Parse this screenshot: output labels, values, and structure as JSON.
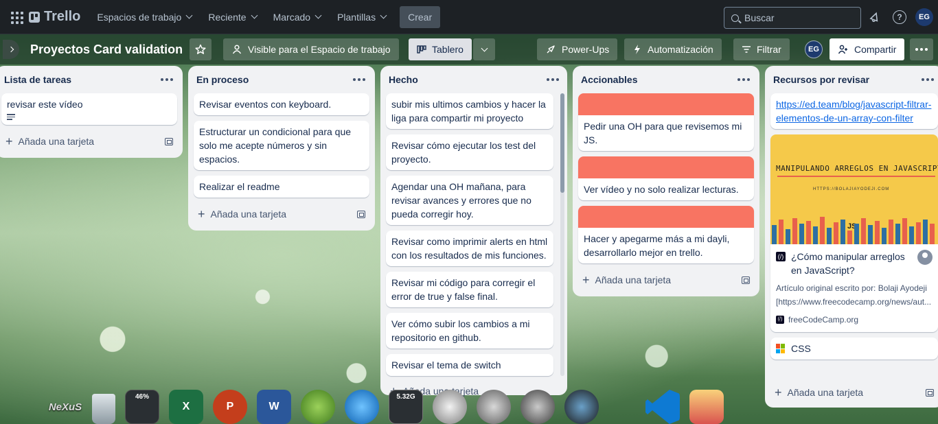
{
  "topbar": {
    "app_name": "Trello",
    "nav": [
      "Espacios de trabajo",
      "Reciente",
      "Marcado",
      "Plantillas"
    ],
    "create_label": "Crear",
    "search_placeholder": "Buscar",
    "avatar_initials": "EG"
  },
  "board": {
    "title": "Proyectos Card validation",
    "visibility_label": "Visible para el Espacio de trabajo",
    "view_label": "Tablero",
    "powerups_label": "Power-Ups",
    "automation_label": "Automatización",
    "filter_label": "Filtrar",
    "member_initials": "EG",
    "share_label": "Compartir"
  },
  "add_card_label": "Añada una tarjeta",
  "lists": [
    {
      "title": "Lista de tareas",
      "cards": [
        {
          "text": "revisar este vídeo"
        }
      ]
    },
    {
      "title": "En proceso",
      "cards": [
        {
          "text": "Revisar eventos con keyboard."
        },
        {
          "text": "Estructurar un condicional para que solo me acepte números y sin espacios."
        },
        {
          "text": "Realizar el readme"
        }
      ]
    },
    {
      "title": "Hecho",
      "cards": [
        {
          "text": "subir mis ultimos cambios y hacer la liga para compartir mi proyecto"
        },
        {
          "text": "Revisar cómo ejecutar los test del proyecto."
        },
        {
          "text": "Agendar una OH mañana, para revisar avances y errores que no pueda corregir hoy."
        },
        {
          "text": "Revisar como imprimir alerts en html con los resultados de mis funciones."
        },
        {
          "text": "Revisar mi código para corregir el error de true y false final."
        },
        {
          "text": "Ver cómo subir los cambios a mi repositorio en github."
        },
        {
          "text": "Revisar el tema de switch"
        }
      ]
    },
    {
      "title": "Accionables",
      "cover_color": "#f87462",
      "cards": [
        {
          "text": "Pedir una OH para que revisemos mi JS."
        },
        {
          "text": "Ver vídeo y no solo realizar lecturas."
        },
        {
          "text": "Hacer y apegarme más a mi dayli, desarrollarlo mejor en trello."
        }
      ]
    },
    {
      "title": "Recursos por revisar",
      "cards": [
        {
          "link": "https://ed.team/blog/javascript-filtrar-elementos-de-un-array-con-filter"
        },
        {
          "image_title": "MANIPULANDO ARREGLOS EN JAVASCRIPT",
          "image_url": "HTTPS://BOLAJIAYODEJI.COM",
          "image_js": "JS",
          "title": "¿Cómo manipular arreglos en JavaScript?",
          "desc1": "Artículo original escrito por: Bolaji Ayodeji",
          "desc2": "[https://www.freecodecamp.org/news/aut...",
          "source": "freeCodeCamp.org"
        },
        {
          "text": "CSS"
        }
      ]
    }
  ],
  "dock": {
    "nexus_label": "NeXuS",
    "cpu_label": "46%",
    "excel": "X",
    "powerpoint": "P",
    "word": "W",
    "drive_label": "5.32G"
  }
}
